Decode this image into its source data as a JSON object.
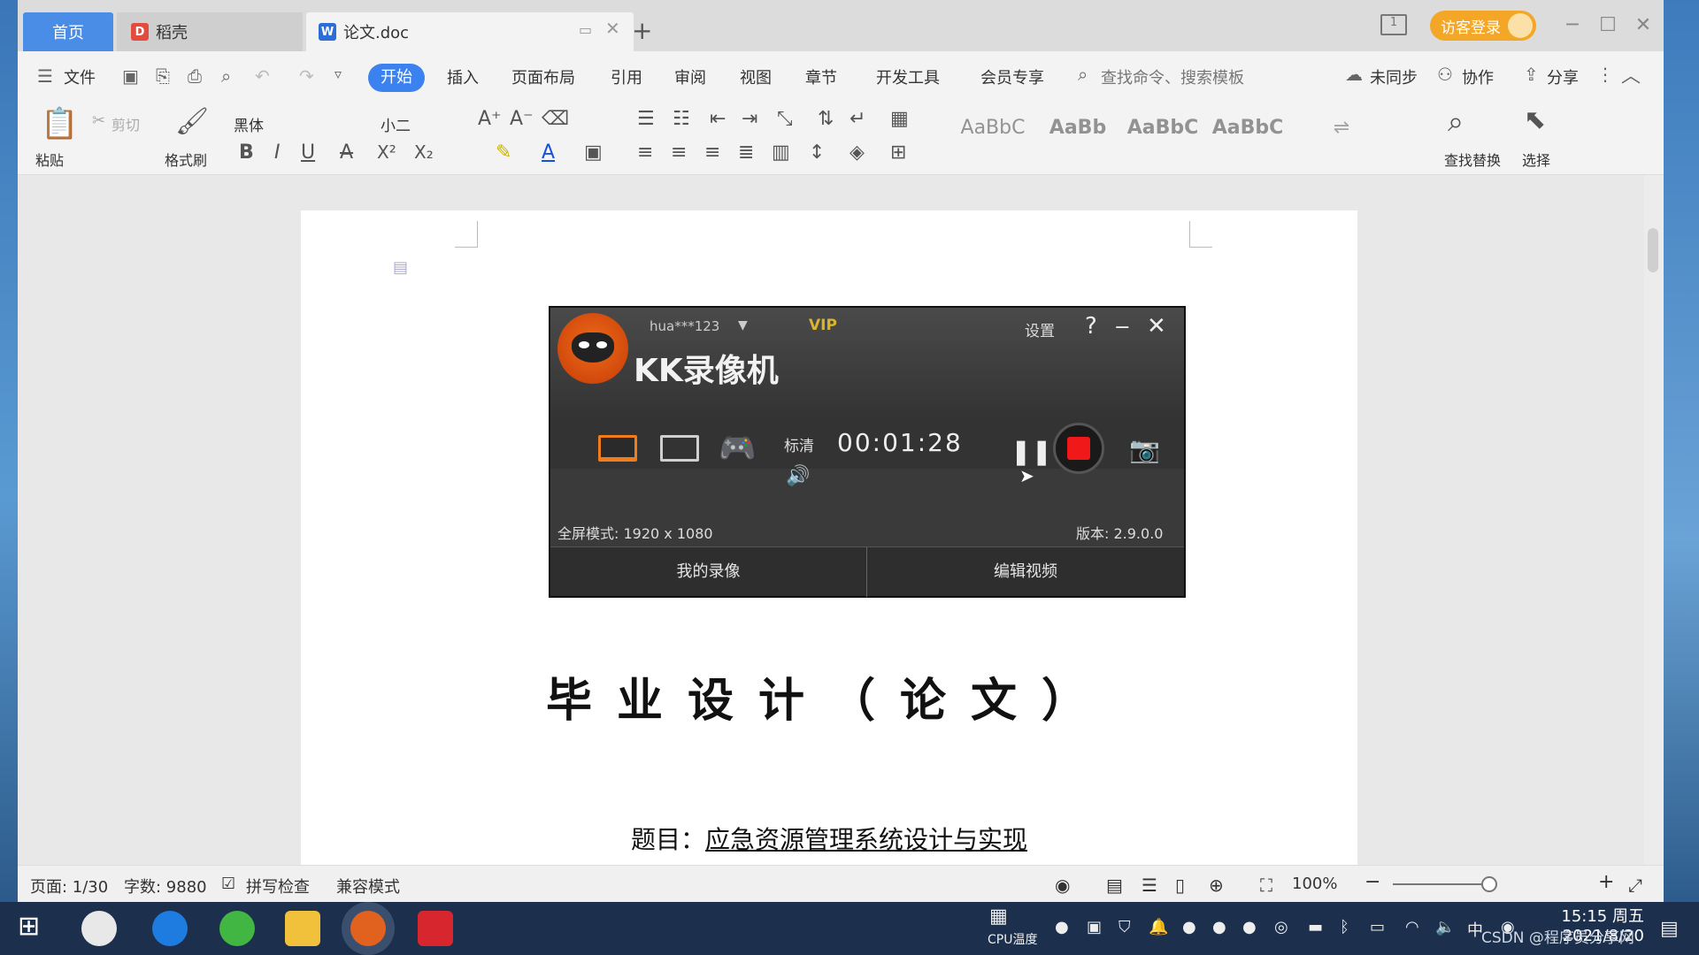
{
  "tabs": {
    "home": "首页",
    "daoke": "稻壳",
    "doc": "论文.doc"
  },
  "titlebar": {
    "guest_login": "访客登录"
  },
  "menu": {
    "file": "文件",
    "start": "开始",
    "insert": "插入",
    "layout": "页面布局",
    "reference": "引用",
    "review": "审阅",
    "view": "视图",
    "chapter": "章节",
    "dev_tools": "开发工具",
    "member": "会员专享",
    "search_placeholder": "查找命令、搜索模板",
    "unsynced": "未同步",
    "collaborate": "协作",
    "share": "分享"
  },
  "ribbon": {
    "paste": "粘贴",
    "cut": "剪切",
    "format_painter": "格式刷",
    "font_name": "黑体",
    "font_size": "小二",
    "find_replace": "查找替换",
    "select": "选择"
  },
  "document": {
    "title": "毕业设计（论文）",
    "subject_prefix": "题目：",
    "subject": "应急资源管理系统设计与实现"
  },
  "status": {
    "page": "页面: 1/30",
    "words": "字数: 9880",
    "spellcheck": "拼写检查",
    "compat_mode": "兼容模式",
    "zoom": "100%"
  },
  "recorder": {
    "app_name": "KK录像机",
    "user": "hua***123",
    "vip": "VIP",
    "settings": "设置",
    "quality": "标清",
    "timer": "00:01:28",
    "fullscreen_mode": "全屏模式: 1920 x 1080",
    "version": "版本: 2.9.0.0",
    "my_recordings": "我的录像",
    "edit_video": "编辑视频",
    "accent_color": "#f07c1c",
    "record_color": "#f01818"
  },
  "taskbar": {
    "cpu_temp": "CPU温度",
    "time": "15:15 周五",
    "date": "2021/8/20",
    "ime": "中",
    "watermark": "CSDN @程序员分享网"
  }
}
